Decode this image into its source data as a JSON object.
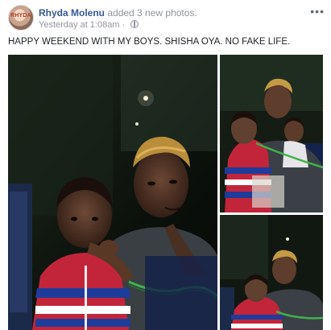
{
  "post": {
    "author": "Rhyda Molenu",
    "action": " added 3 new photos.",
    "timestamp": "Yesterday at 1:08am",
    "separator": " · ",
    "more_label": "•••",
    "caption": "HAPPY WEEKEND WITH MY BOYS. SHISHA OYA. NO FAKE LIFE.",
    "avatar_text": "RHYDA"
  },
  "photos": [
    {
      "name": "photo-main"
    },
    {
      "name": "photo-top-right"
    },
    {
      "name": "photo-bottom-right"
    }
  ],
  "colors": {
    "author": "#365899",
    "meta": "#90949c",
    "text": "#1d2129"
  },
  "icons": [
    "globe-icon",
    "more-options-icon"
  ]
}
